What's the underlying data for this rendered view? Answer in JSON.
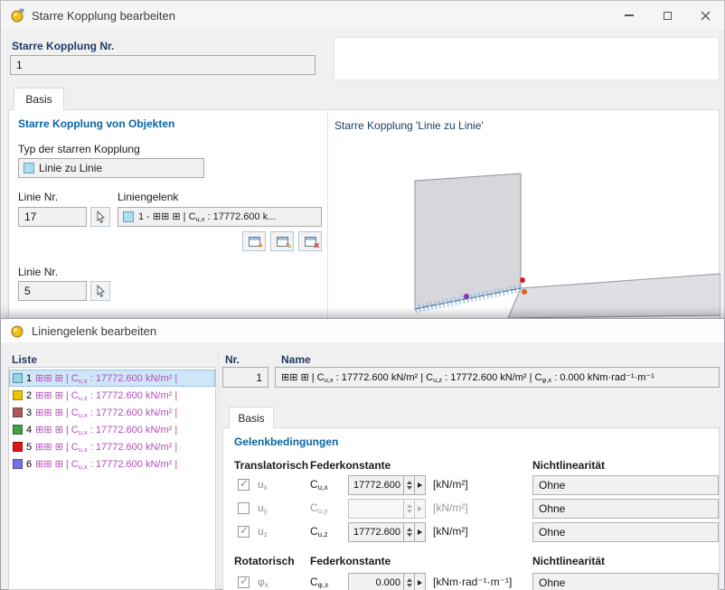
{
  "colors": {
    "accent_blue": "#0a64a4",
    "label_navy": "#1e3c64",
    "list_text_magenta": "#b44cb8",
    "selection_bg": "#cfe6f8",
    "type_chip_cyan": "#aadff0"
  },
  "icons": {
    "app_icon": "gold-coupling",
    "pick_icon": "cursor-arrow",
    "new_icon": "new-dialog",
    "edit_icon": "edit-dialog",
    "delete_icon": "delete-dialog"
  },
  "window_top": {
    "title": "Starre Kopplung bearbeiten",
    "number_label": "Starre Kopplung Nr.",
    "number_value": "1",
    "tab_basis": "Basis",
    "section_objects": "Starre Kopplung von Objekten",
    "type_label": "Typ der starren Kopplung",
    "type_value": "Linie zu Linie",
    "line_nr_label_1": "Linie Nr.",
    "line_nr_value_1": "17",
    "liniengelenk_label": "Liniengelenk",
    "liniengelenk_value_html": "1 - ⊞⊞ ⊞ | C<sub>u,x</sub> : 17772.600 k...",
    "line_nr_label_2": "Linie Nr.",
    "line_nr_value_2": "5",
    "preview_title": "Starre Kopplung 'Linie zu Linie'"
  },
  "window_bottom": {
    "title": "Liniengelenk bearbeiten",
    "liste_label": "Liste",
    "list_items": [
      {
        "num": "1",
        "color": "#8ed6e8",
        "text_html": "⊞⊞ ⊞ | C<sub>u,x</sub> : 17772.600 kN/m² |",
        "selected": true
      },
      {
        "num": "2",
        "color": "#f0c400",
        "text_html": "⊞⊞ ⊞ | C<sub>u,x</sub> : 17772.600 kN/m² |",
        "selected": false
      },
      {
        "num": "3",
        "color": "#aa5a5a",
        "text_html": "⊞⊞ ⊞ | C<sub>u,x</sub> : 17772.600 kN/m² |",
        "selected": false
      },
      {
        "num": "4",
        "color": "#46a046",
        "text_html": "⊞⊞ ⊞ | C<sub>u,x</sub> : 17772.600 kN/m² |",
        "selected": false
      },
      {
        "num": "5",
        "color": "#e41414",
        "text_html": "⊞⊞ ⊞ | C<sub>u,x</sub> : 17772.600 kN/m² |",
        "selected": false
      },
      {
        "num": "6",
        "color": "#7472e8",
        "text_html": "⊞⊞ ⊞ | C<sub>u,x</sub> : 17772.600 kN/m² |",
        "selected": false
      }
    ],
    "nr_label": "Nr.",
    "nr_value": "1",
    "name_label": "Name",
    "name_value_html": "⊞⊞ ⊞ | C<sub>u,x</sub> : 17772.600 kN/m² | C<sub>u,z</sub> : 17772.600 kN/m² | C<sub>φ,x</sub> : 0.000 kNm·rad⁻¹·m⁻¹",
    "tab_basis": "Basis",
    "section_conditions": "Gelenkbedingungen",
    "translational_header": "Translatorisch",
    "spring_header": "Federkonstante",
    "nonlinearity_header": "Nichtlinearität",
    "rows": [
      {
        "dof_html": "u<sub>x</sub>",
        "const_html": "C<sub>u,x</sub>",
        "value": "17772.600",
        "unit": "[kN/m²]",
        "nonlin": "Ohne",
        "checked": true,
        "enabled": true
      },
      {
        "dof_html": "u<sub>y</sub>",
        "const_html": "C<sub>u,y</sub>",
        "value": "",
        "unit": "[kN/m²]",
        "nonlin": "Ohne",
        "checked": false,
        "enabled": false
      },
      {
        "dof_html": "u<sub>z</sub>",
        "const_html": "C<sub>u,z</sub>",
        "value": "17772.600",
        "unit": "[kN/m²]",
        "nonlin": "Ohne",
        "checked": true,
        "enabled": true
      }
    ],
    "rotational_header": "Rotatorisch",
    "spring_header_2": "Federkonstante",
    "nonlinearity_header_2": "Nichtlinearität",
    "rot_row": {
      "dof_html": "φ<sub>x</sub>",
      "const_html": "C<sub>φ,x</sub>",
      "value": "0.000",
      "unit": "[kNm·rad⁻¹·m⁻¹]",
      "nonlin": "Ohne",
      "checked": true,
      "enabled": true
    }
  }
}
